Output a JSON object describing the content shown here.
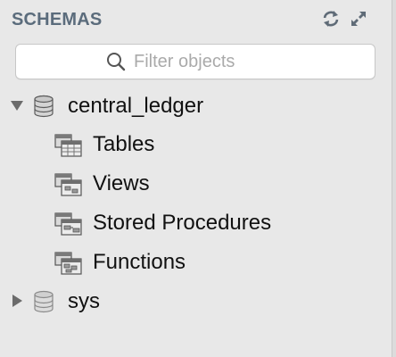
{
  "header": {
    "title": "SCHEMAS",
    "refresh_icon": "refresh-icon",
    "expand_icon": "expand-icon"
  },
  "search": {
    "placeholder": "Filter objects",
    "value": ""
  },
  "tree": {
    "schemas": [
      {
        "name": "central_ledger",
        "expanded": true,
        "children": [
          {
            "label": "Tables",
            "icon": "tables-icon"
          },
          {
            "label": "Views",
            "icon": "views-icon"
          },
          {
            "label": "Stored Procedures",
            "icon": "stored-procedures-icon"
          },
          {
            "label": "Functions",
            "icon": "functions-icon"
          }
        ]
      },
      {
        "name": "sys",
        "expanded": false,
        "children": []
      }
    ]
  },
  "colors": {
    "panel_bg": "#e8e8e8",
    "header_text": "#5b6c7c",
    "item_text": "#111111"
  }
}
